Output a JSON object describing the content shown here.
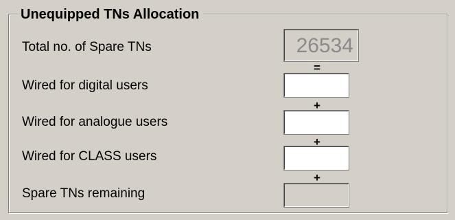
{
  "group": {
    "title": "Unequipped TNs Allocation"
  },
  "rows": [
    {
      "label": "Total no. of Spare TNs",
      "value": "26534",
      "enabled": false
    },
    {
      "label": "Wired for digital users",
      "value": "",
      "enabled": true
    },
    {
      "label": "Wired for analogue users",
      "value": "",
      "enabled": true
    },
    {
      "label": "Wired for CLASS users",
      "value": "",
      "enabled": true
    },
    {
      "label": "Spare TNs remaining",
      "value": "",
      "enabled": false
    }
  ],
  "operators": [
    "=",
    "+",
    "+",
    "+"
  ],
  "colors": {
    "background": "#d4d0c8",
    "field_background": "#ffffff",
    "disabled_text": "#8a8a8a"
  }
}
